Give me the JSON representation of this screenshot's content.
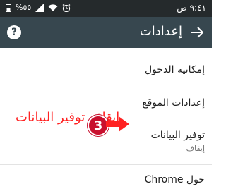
{
  "status_bar": {
    "time_text": "٩:٤١ ص",
    "battery_text": "%٥٥"
  },
  "toolbar": {
    "title": "إعدادات",
    "back_icon": "arrow-back-icon",
    "help_icon": "help-icon"
  },
  "settings_list": [
    {
      "title": "إمكانية الدخول",
      "subtitle": ""
    },
    {
      "title": "إعدادات الموقع",
      "subtitle": ""
    },
    {
      "title": "توفير البيانات",
      "subtitle": "إيقاف"
    },
    {
      "title": "حول Chrome",
      "subtitle": ""
    }
  ],
  "annotation": {
    "text": "ايقاف توفير البيانات",
    "step_number": "3",
    "color": "#ff2222"
  },
  "colors": {
    "status_bar": "#252a2c",
    "toolbar": "#37474f"
  }
}
